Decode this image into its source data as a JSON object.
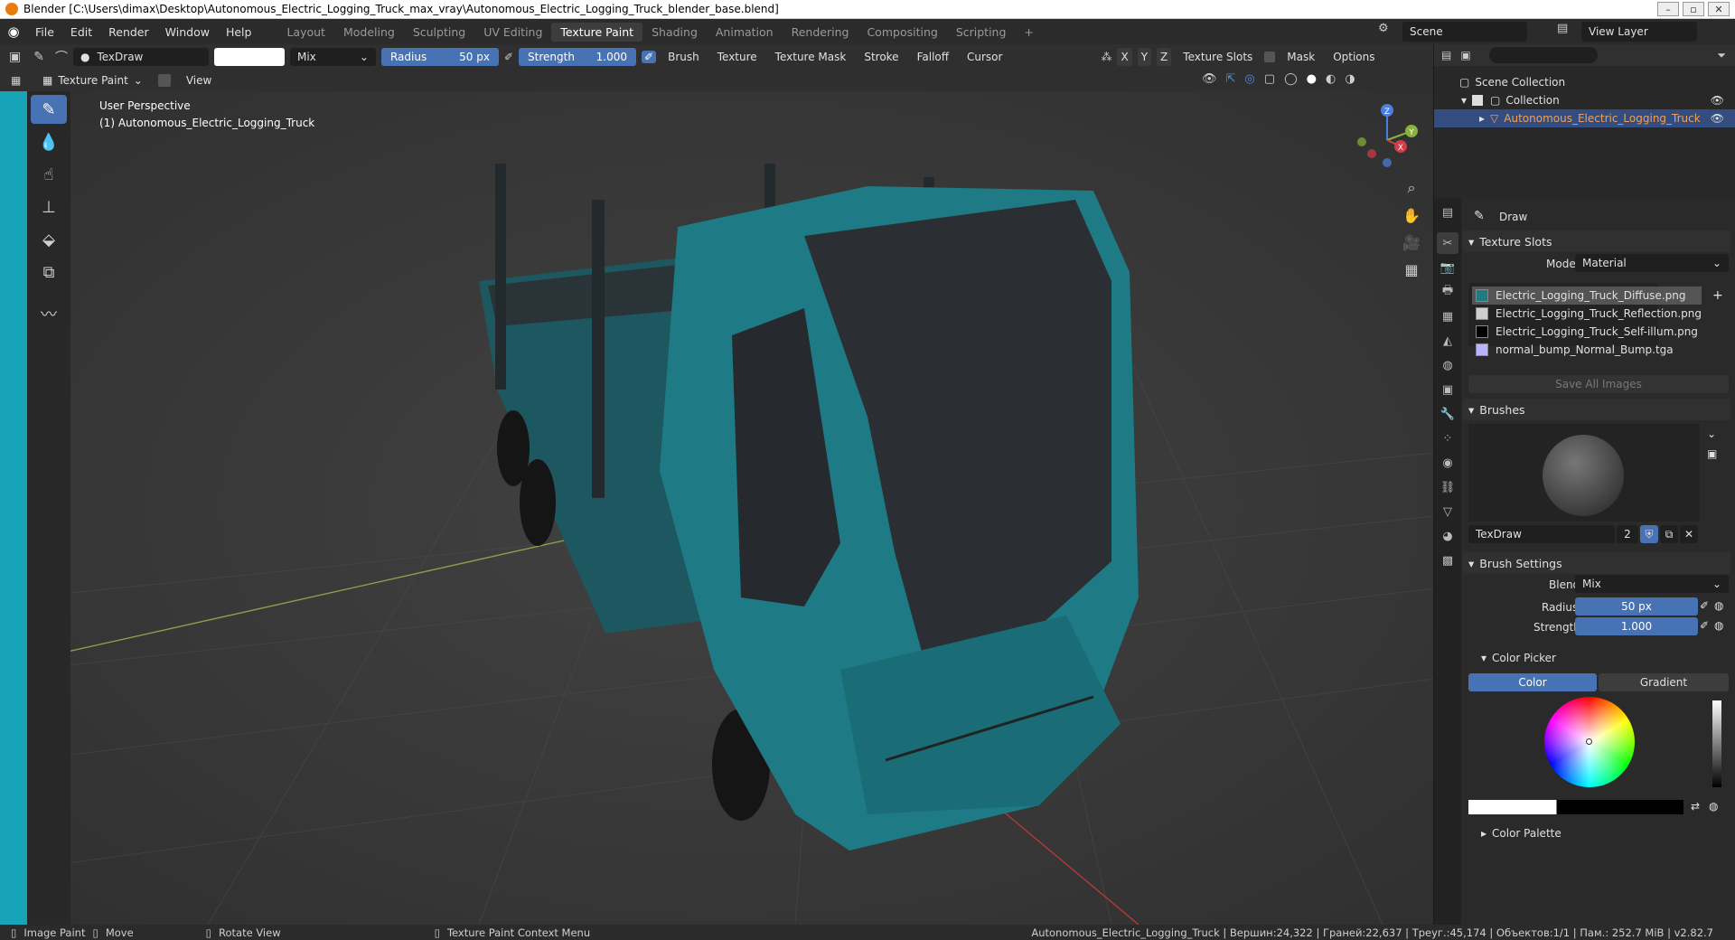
{
  "window": {
    "title": "Blender [C:\\Users\\dimax\\Desktop\\Autonomous_Electric_Logging_Truck_max_vray\\Autonomous_Electric_Logging_Truck_blender_base.blend]"
  },
  "menu": {
    "items": [
      "File",
      "Edit",
      "Render",
      "Window",
      "Help"
    ]
  },
  "workspaces": [
    "Layout",
    "Modeling",
    "Sculpting",
    "UV Editing",
    "Texture Paint",
    "Shading",
    "Animation",
    "Rendering",
    "Compositing",
    "Scripting"
  ],
  "scene": {
    "name": "Scene",
    "view_layer": "View Layer"
  },
  "tool_header": {
    "brush_name": "TexDraw",
    "blend": "Mix",
    "radius_label": "Radius",
    "radius_value": "50 px",
    "strength_label": "Strength",
    "strength_value": "1.000",
    "menus": [
      "Brush",
      "Texture",
      "Texture Mask",
      "Stroke",
      "Falloff",
      "Cursor"
    ],
    "axes": [
      "X",
      "Y",
      "Z"
    ],
    "texture_slots": "Texture Slots",
    "mask": "Mask",
    "options": "Options"
  },
  "mode_header": {
    "mode": "Texture Paint",
    "view": "View"
  },
  "viewport": {
    "perspective": "User Perspective",
    "object": "(1) Autonomous_Electric_Logging_Truck"
  },
  "gizmo": {
    "x": "X",
    "y": "Y",
    "z": "Z"
  },
  "outliner": {
    "scene_collection": "Scene Collection",
    "collection": "Collection",
    "object": "Autonomous_Electric_Logging_Truck"
  },
  "properties": {
    "tool": "Draw",
    "texture_slots": {
      "header": "Texture Slots",
      "mode_label": "Mode",
      "mode_value": "Material",
      "slots": [
        {
          "name": "Electric_Logging_Truck_Diffuse.png",
          "color": "#1e7a85"
        },
        {
          "name": "Electric_Logging_Truck_Reflection.png",
          "color": "#cfcfcf"
        },
        {
          "name": "Electric_Logging_Truck_Self-illum.png",
          "color": "#000000"
        },
        {
          "name": "normal_bump_Normal_Bump.tga",
          "color": "#b9b4ff"
        }
      ],
      "save_all": "Save All Images"
    },
    "brushes": {
      "header": "Brushes",
      "name": "TexDraw",
      "users": "2"
    },
    "brush_settings": {
      "header": "Brush Settings",
      "blend_label": "Blend",
      "blend_value": "Mix",
      "radius_label": "Radius",
      "radius_value": "50 px",
      "strength_label": "Strength",
      "strength_value": "1.000"
    },
    "color_picker": {
      "header": "Color Picker",
      "tab_color": "Color",
      "tab_gradient": "Gradient"
    },
    "color_palette": {
      "header": "Color Palette"
    }
  },
  "status": {
    "image_paint": "Image Paint",
    "move": "Move",
    "rotate": "Rotate View",
    "context_menu": "Texture Paint Context Menu",
    "stats": "Autonomous_Electric_Logging_Truck | Вершин:24,322 | Граней:22,637 | Треуг.:45,174 | Объектов:1/1 | Пам.: 252.7 MiB | v2.82.7"
  },
  "colors": {
    "accent": "#4772b3",
    "truck": "#1e7a85",
    "active_object": "#f0a05a"
  }
}
